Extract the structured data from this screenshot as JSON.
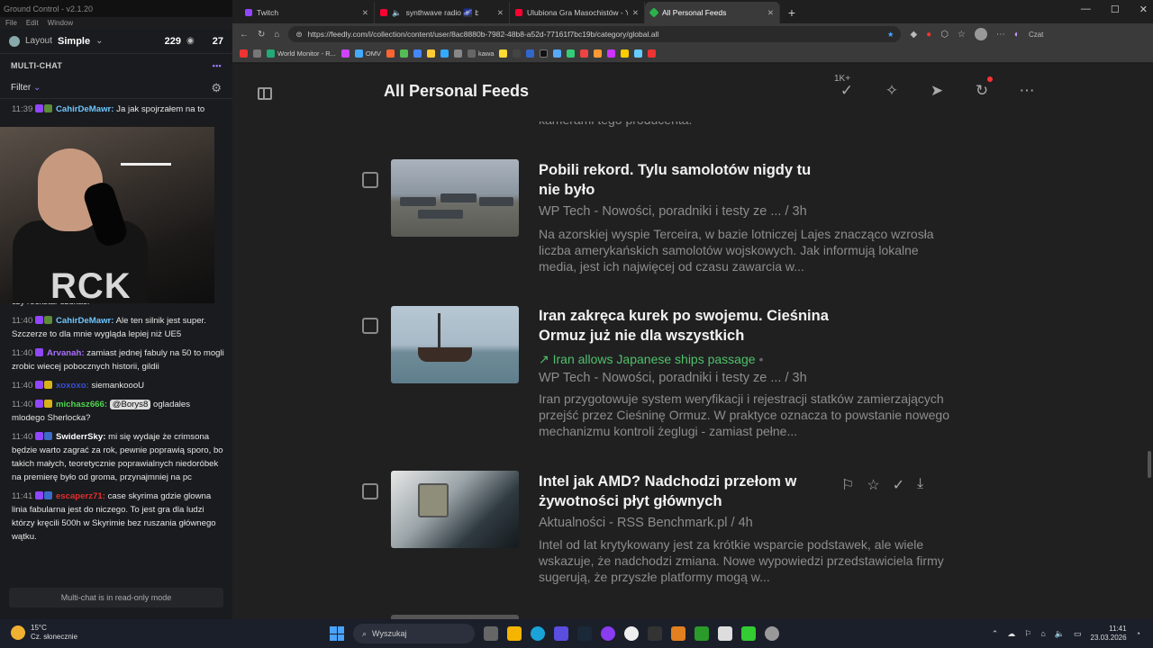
{
  "app": {
    "title": "Ground Control - v2.1.20",
    "menu": [
      "File",
      "Edit",
      "Window"
    ]
  },
  "gc_header": {
    "layout_label": "Layout",
    "layout_value": "Simple",
    "viewers": "229",
    "second_count": "27"
  },
  "multichat": {
    "title": "MULTI-CHAT",
    "filter": "Filter",
    "readonly": "Multi-chat is in read-only mode"
  },
  "chat": {
    "top": {
      "time": "11:39",
      "user": "CahirDeMawr:",
      "text": "Ja jak spojrzałem na to"
    },
    "partial": "premierą było wiadomo żeby tam się poziomu CDPR czy rockstar szukać.",
    "messages": [
      {
        "time": "11:40",
        "user": "CahirDeMawr:",
        "text": "Ale ten silnik jest super. Szczerze to dla mnie wygląda lepiej niż UE5",
        "color": "#6ec6ff"
      },
      {
        "time": "11:40",
        "user": "Arvanah:",
        "text": "zamiast jednej fabuly na 50 to mogli zrobic wiecej pobocznych historii, gildii",
        "color": "#a970ff"
      },
      {
        "time": "11:40",
        "user": "xoxoxo:",
        "text": "siemankoooU",
        "color": "#3a4fd0"
      },
      {
        "time": "11:40",
        "user": "michasz666:",
        "text": "ogladales mlodego Sherlocka?",
        "mention": "@Borys8",
        "color": "#4fd64f"
      },
      {
        "time": "11:40",
        "user": "SwiderrSky:",
        "text": "mi się wydaje że crimsona będzie warto zagrać za rok, pewnie poprawią sporo, bo takich małych, teoretycznie poprawialnych niedoróbek na premierę było od groma, przynajmniej na pc",
        "color": "#ffffff"
      },
      {
        "time": "11:41",
        "user": "escaperz71:",
        "text": "case skyrima gdzie glowna linia fabularna jest do niczego. To jest gra dla ludzi którzy kręcili 500h w Skyrimie bez ruszania głównego wątku.",
        "color": "#e03030"
      }
    ]
  },
  "webcam": {
    "shirt_text": "RCK"
  },
  "browser": {
    "tabs": [
      {
        "label": "Twitch",
        "color": "#9146ff"
      },
      {
        "label": "synthwave radio 🌌 beats to",
        "color": "#ff0033"
      },
      {
        "label": "Ulubiona Gra Masochistów - YouTube",
        "color": "#ff0033"
      },
      {
        "label": "All Personal Feeds",
        "color": "#2bb24c",
        "active": true
      }
    ],
    "url": "https://feedly.com/i/collection/content/user/8ac8880b-7982-48b8-a52d-77161f7bc19b/category/global.all",
    "profile_label": "Czat",
    "bookmarks": [
      "World Monitor - R...",
      "OMV",
      "kawa"
    ]
  },
  "feedly": {
    "title": "All Personal Feeds",
    "unread": "1K+",
    "cut_text": "kamerami tego producenta.",
    "articles": [
      {
        "title": "Pobili rekord. Tylu samolotów nigdy tu nie było",
        "meta": "WP Tech - Nowości, poradniki i testy ze ... / 3h",
        "summary": "Na azorskiej wyspie Terceira, w bazie lotniczej Lajes znacząco wzrosła liczba amerykańskich samolotów wojskowych. Jak informują lokalne media, jest ich najwięcej od czasu zawarcia w..."
      },
      {
        "title": "Iran zakręca kurek po swojemu. Cieśnina Ormuz już nie dla wszystkich",
        "trend": "Iran allows Japanese ships passage",
        "meta": "WP Tech - Nowości, poradniki i testy ze ... / 3h",
        "summary": "Iran przygotowuje system weryfikacji i rejestracji statków zamierzających przejść przez Cieśninę Ormuz. W praktyce oznacza to powstanie nowego mechanizmu kontroli żeglugi - zamiast pełne..."
      },
      {
        "title": "Intel jak AMD? Nadchodzi przełom w żywotności płyt głównych",
        "meta": "Aktualności - RSS Benchmark.pl / 4h",
        "summary": "Intel od lat krytykowany jest za krótkie wsparcie podstawek, ale wiele wskazuje, że nadchodzi zmiana. Nowe wypowiedzi przedstawiciela firmy sugerują, że przyszłe platformy mogą w..."
      }
    ]
  },
  "taskbar": {
    "temp": "15°C",
    "weather": "Cz. słonecznie",
    "search": "Wyszukaj",
    "time": "11:41",
    "date": "23.03.2026"
  }
}
